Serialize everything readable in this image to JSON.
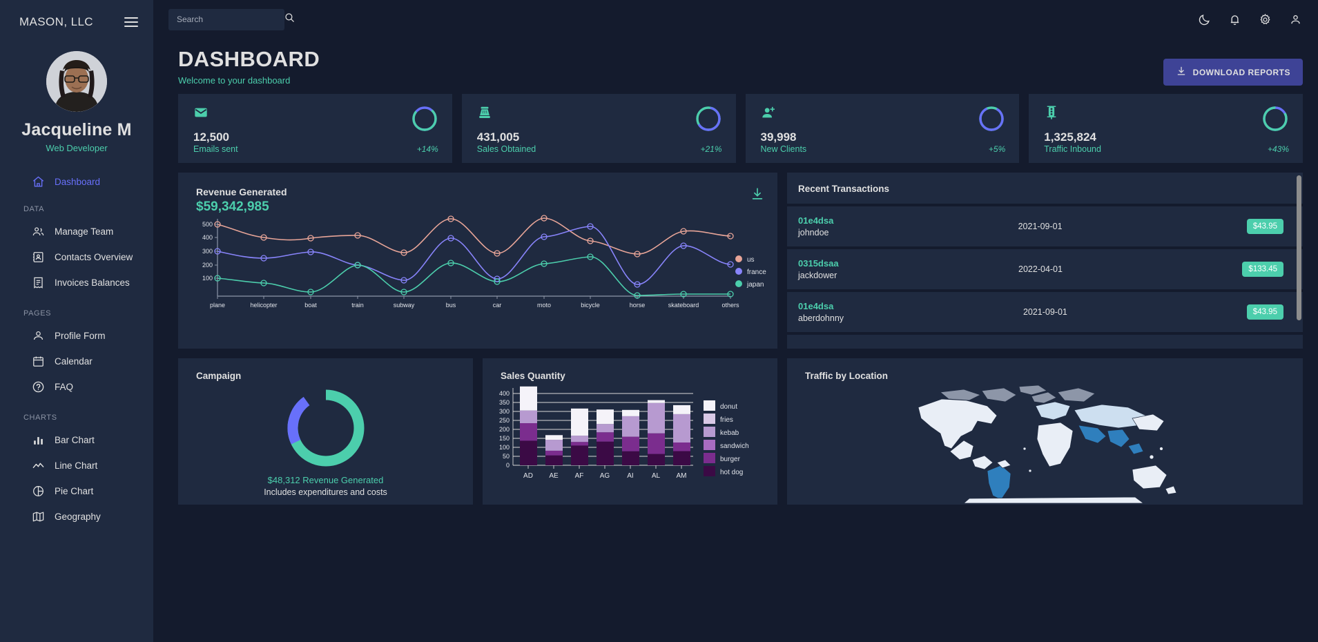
{
  "sidebar": {
    "brand": "MASON, LLC",
    "menu_icon": "hamburger-icon",
    "profile": {
      "name": "Jacqueline M",
      "role": "Web Developer",
      "avatar": "user-photo"
    },
    "nav": [
      {
        "label": "Dashboard",
        "icon": "home-icon",
        "active": true
      },
      {
        "section": "DATA"
      },
      {
        "label": "Manage Team",
        "icon": "people-icon",
        "active": false
      },
      {
        "label": "Contacts Overview",
        "icon": "contacts-icon",
        "active": false
      },
      {
        "label": "Invoices Balances",
        "icon": "receipt-icon",
        "active": false
      },
      {
        "section": "PAGES"
      },
      {
        "label": "Profile Form",
        "icon": "person-icon",
        "active": false
      },
      {
        "label": "Calendar",
        "icon": "calendar-icon",
        "active": false
      },
      {
        "label": "FAQ",
        "icon": "help-icon",
        "active": false
      },
      {
        "section": "CHARTS"
      },
      {
        "label": "Bar Chart",
        "icon": "bar-chart-icon",
        "active": false
      },
      {
        "label": "Line Chart",
        "icon": "line-chart-icon",
        "active": false
      },
      {
        "label": "Pie Chart",
        "icon": "pie-chart-icon",
        "active": false
      },
      {
        "label": "Geography",
        "icon": "map-icon",
        "active": false
      }
    ]
  },
  "topbar": {
    "search": {
      "placeholder": "Search",
      "value": "",
      "icon": "search-icon"
    },
    "icons": [
      "dark-mode-icon",
      "notifications-icon",
      "settings-icon",
      "account-icon"
    ]
  },
  "header": {
    "title": "DASHBOARD",
    "subtitle": "Welcome to your dashboard",
    "download_button": "DOWNLOAD REPORTS",
    "download_icon": "download-icon"
  },
  "stats": [
    {
      "icon": "email-icon",
      "value": "12,500",
      "label": "Emails sent",
      "increase": "+14%",
      "progress": 0.75,
      "color": "#4cceac"
    },
    {
      "icon": "sales-icon",
      "value": "431,005",
      "label": "Sales Obtained",
      "increase": "+21%",
      "progress": 0.5,
      "color": "#6870fa"
    },
    {
      "icon": "person-add-icon",
      "value": "39,998",
      "label": "New Clients",
      "increase": "+5%",
      "progress": 0.3,
      "color": "#6870fa"
    },
    {
      "icon": "traffic-icon",
      "value": "1,325,824",
      "label": "Traffic Inbound",
      "increase": "+43%",
      "progress": 0.8,
      "color": "#4cceac"
    }
  ],
  "revenue": {
    "title": "Revenue Generated",
    "amount": "$59,342,985",
    "download_icon": "download-icon"
  },
  "transactions": {
    "title": "Recent Transactions",
    "rows": [
      {
        "txId": "01e4dsa",
        "user": "johndoe",
        "date": "2021-09-01",
        "cost": "$43.95"
      },
      {
        "txId": "0315dsaa",
        "user": "jackdower",
        "date": "2022-04-01",
        "cost": "$133.45"
      },
      {
        "txId": "01e4dsa",
        "user": "aberdohnny",
        "date": "2021-09-01",
        "cost": "$43.95"
      }
    ]
  },
  "campaign": {
    "title": "Campaign",
    "caption": "$48,312 Revenue Generated",
    "sub": "Includes expenditures and costs"
  },
  "sales_panel": {
    "title": "Sales Quantity"
  },
  "traffic_panel": {
    "title": "Traffic by Location"
  },
  "chart_data": [
    {
      "type": "line",
      "title": "Revenue Generated",
      "xlabel": "",
      "ylabel": "",
      "grid": false,
      "legend_position": "right",
      "ylim": [
        0,
        560
      ],
      "yticks": [
        100,
        200,
        300,
        400,
        500
      ],
      "x": [
        "plane",
        "helicopter",
        "boat",
        "train",
        "subway",
        "bus",
        "car",
        "moto",
        "bicycle",
        "horse",
        "skateboard",
        "others"
      ],
      "series": [
        {
          "name": "us",
          "color": "#e8a598",
          "values": [
            500,
            400,
            395,
            420,
            310,
            552,
            305,
            555,
            375,
            275,
            450,
            432
          ]
        },
        {
          "name": "france",
          "color": "#8884fb",
          "values": [
            310,
            260,
            302,
            215,
            110,
            410,
            120,
            415,
            480,
            90,
            350,
            272
          ]
        },
        {
          "name": "japan",
          "color": "#4cceac",
          "values": [
            100,
            75,
            30,
            215,
            32,
            237,
            88,
            228,
            280,
            5,
            25,
            22
          ]
        }
      ]
    },
    {
      "type": "pie",
      "title": "Campaign",
      "donut": true,
      "labels": [
        "generated",
        "expenditures"
      ],
      "values": [
        78,
        22
      ],
      "colors": [
        "#4cceac",
        "#6870fa"
      ]
    },
    {
      "type": "bar",
      "title": "Sales Quantity",
      "stacked": true,
      "grid": true,
      "legend_position": "right",
      "categories": [
        "AD",
        "AE",
        "AF",
        "AG",
        "AI",
        "AL",
        "AM"
      ],
      "ylim": [
        0,
        440
      ],
      "yticks": [
        0,
        50,
        100,
        150,
        200,
        250,
        300,
        350,
        400
      ],
      "series": [
        {
          "name": "hot dog",
          "color": "#3b0a45",
          "values": [
            137,
            55,
            110,
            132,
            78,
            63,
            79
          ]
        },
        {
          "name": "burger",
          "color": "#7b2d8e",
          "values": [
            98,
            26,
            20,
            52,
            81,
            115,
            48
          ]
        },
        {
          "name": "sandwich",
          "color": "#a86cc1",
          "values": [
            0,
            0,
            0,
            0,
            0,
            0,
            0
          ]
        },
        {
          "name": "kebab",
          "color": "#b79ad0",
          "values": [
            71,
            61,
            35,
            46,
            114,
            169,
            158
          ]
        },
        {
          "name": "fries",
          "color": "#d9c9e6",
          "values": [
            0,
            0,
            0,
            0,
            0,
            0,
            0
          ]
        },
        {
          "name": "donut",
          "color": "#f5f3f9",
          "values": [
            134,
            26,
            151,
            81,
            35,
            16,
            50
          ]
        }
      ]
    },
    {
      "type": "map",
      "title": "Traffic by Location"
    }
  ]
}
